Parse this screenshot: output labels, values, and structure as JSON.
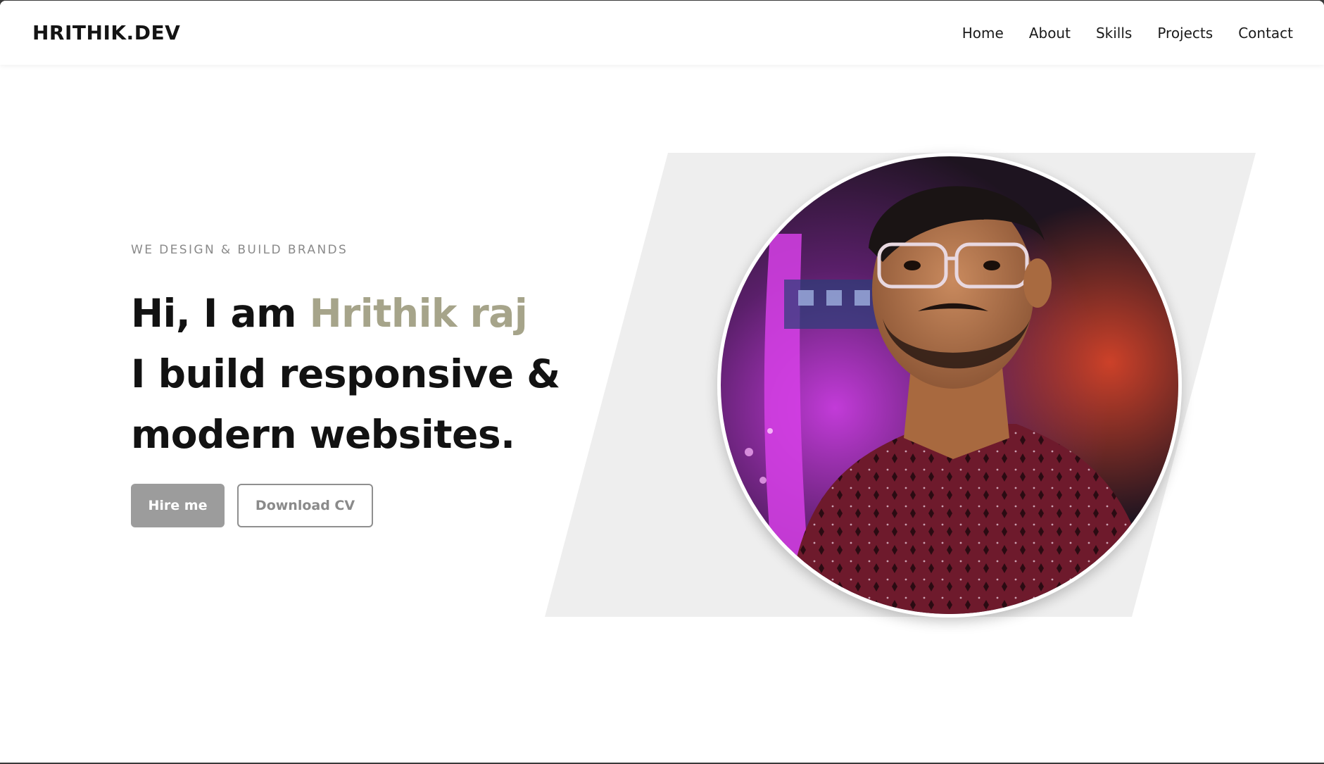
{
  "brand": {
    "name": "HRITHIK.DEV"
  },
  "nav": {
    "items": [
      {
        "label": "Home"
      },
      {
        "label": "About"
      },
      {
        "label": "Skills"
      },
      {
        "label": "Projects"
      },
      {
        "label": "Contact"
      }
    ]
  },
  "hero": {
    "tagline": "WE DESIGN & BUILD BRANDS",
    "greeting": "Hi, I am ",
    "name": "Hrithik raj",
    "line2": "I build responsive &",
    "line3": "modern websites.",
    "hire_label": "Hire me",
    "cv_label": "Download CV"
  },
  "colors": {
    "accent": "#a6a48a",
    "primary_button": "#9c9c9c",
    "panel": "#eeeeee",
    "text": "#121212"
  }
}
